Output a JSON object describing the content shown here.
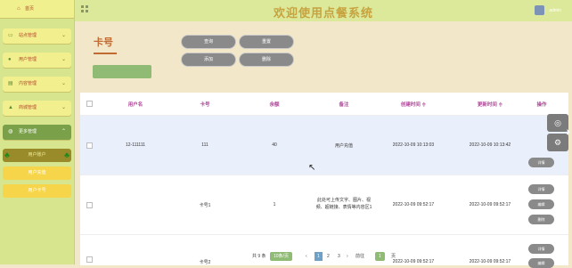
{
  "sidebar": {
    "home": "首页",
    "items": [
      {
        "label": "站点管理",
        "icon": "monitor-icon"
      },
      {
        "label": "用户管理",
        "icon": "user-icon"
      },
      {
        "label": "内容管理",
        "icon": "book-icon"
      },
      {
        "label": "商城管理",
        "icon": "lock-icon"
      }
    ],
    "more": {
      "label": "更多管理",
      "icon": "chat-icon"
    },
    "sub": [
      "用户账户",
      "用户充值",
      "用户卡号"
    ]
  },
  "header": {
    "title": "欢迎使用点餐系统",
    "user": "admin"
  },
  "page": {
    "section_title": "卡号"
  },
  "buttons": {
    "query": "查询",
    "reset": "重置",
    "add": "添加",
    "delete": "删除"
  },
  "table": {
    "headers": [
      "用户名",
      "卡号",
      "余额",
      "备注",
      "创建时间 ≑",
      "更新时间 ≑",
      "操作"
    ],
    "rows": [
      {
        "username": "12-111111",
        "card": "111",
        "balance": "40",
        "remark": "用户充值",
        "created": "2022-10-09 10:13:03",
        "updated": "2022-10-09 10:13:42",
        "ops": [
          "详情"
        ]
      },
      {
        "username": "",
        "card": "卡号1",
        "balance": "1",
        "remark": "此处可上传文字、图片、视频、超链接、表情等内容区1",
        "created": "2022-10-09 09:52:17",
        "updated": "2022-10-09 09:52:17",
        "ops": [
          "详情",
          "编辑",
          "删除"
        ]
      },
      {
        "username": "",
        "card": "卡号2",
        "balance": "",
        "remark": "",
        "created": "2022-10-09 09:52:17",
        "updated": "2022-10-09 09:52:17",
        "ops": [
          "详情",
          "编辑"
        ]
      }
    ]
  },
  "pager": {
    "total": "共 9 条",
    "size": "10条/页",
    "pages": [
      "1",
      "2",
      "3"
    ],
    "goto": "前往",
    "page_input": "1",
    "page_suffix": "页"
  }
}
